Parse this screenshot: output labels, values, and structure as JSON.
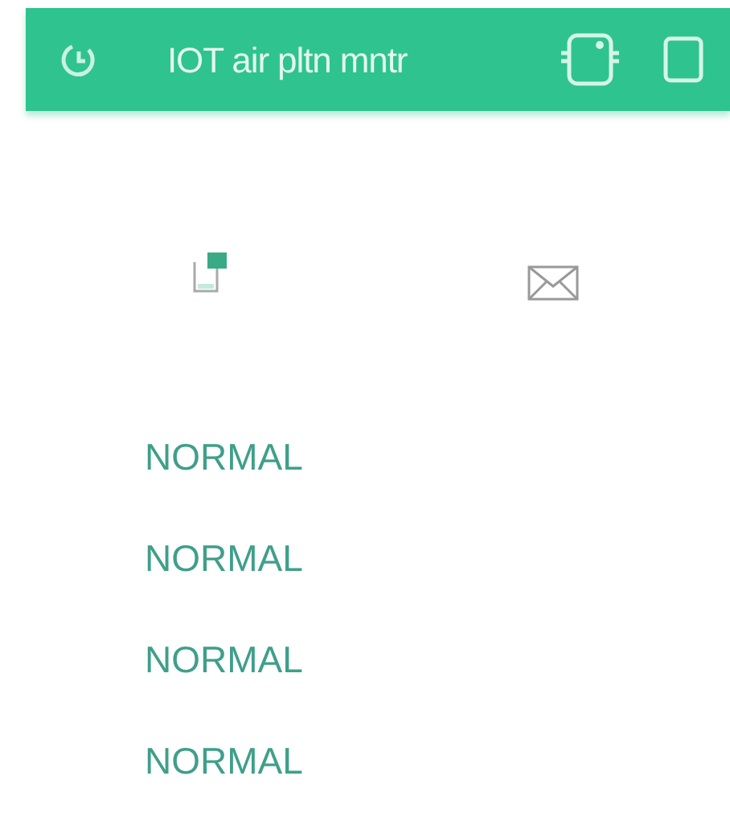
{
  "header": {
    "title": "IOT air pltn mntr"
  },
  "statuses": [
    {
      "value": "NORMAL"
    },
    {
      "value": "NORMAL"
    },
    {
      "value": "NORMAL"
    },
    {
      "value": "NORMAL"
    }
  ]
}
